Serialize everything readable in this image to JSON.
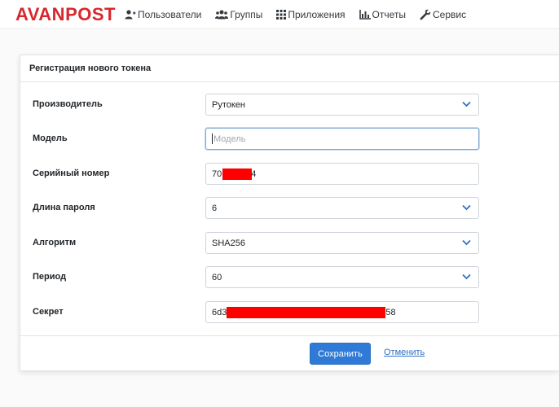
{
  "app": {
    "logo": "AVANPOST"
  },
  "nav": {
    "items": [
      {
        "label": "Пользователи",
        "icon": "user-icon"
      },
      {
        "label": "Группы",
        "icon": "users-icon"
      },
      {
        "label": "Приложения",
        "icon": "grid-icon"
      },
      {
        "label": "Отчеты",
        "icon": "bar-chart-icon"
      },
      {
        "label": "Сервис",
        "icon": "wrench-icon"
      }
    ]
  },
  "form": {
    "title": "Регистрация нового токена",
    "fields": {
      "manufacturer": {
        "label": "Производитель",
        "value": "Рутокен"
      },
      "model": {
        "label": "Модель",
        "placeholder": "Модель",
        "value": ""
      },
      "serial": {
        "label": "Серийный номер",
        "value_prefix": "70",
        "value_suffix": "4"
      },
      "password_length": {
        "label": "Длина пароля",
        "value": "6"
      },
      "algorithm": {
        "label": "Алгоритм",
        "value": "SHA256"
      },
      "period": {
        "label": "Период",
        "value": "60"
      },
      "secret": {
        "label": "Секрет",
        "value_prefix": "6d3",
        "value_suffix": "58"
      }
    },
    "save_label": "Сохранить",
    "cancel_label": "Отменить"
  },
  "colors": {
    "brand": "#d9272e",
    "primary": "#2f7ad6",
    "link": "#2f6fc3",
    "redaction": "#ff0000"
  }
}
